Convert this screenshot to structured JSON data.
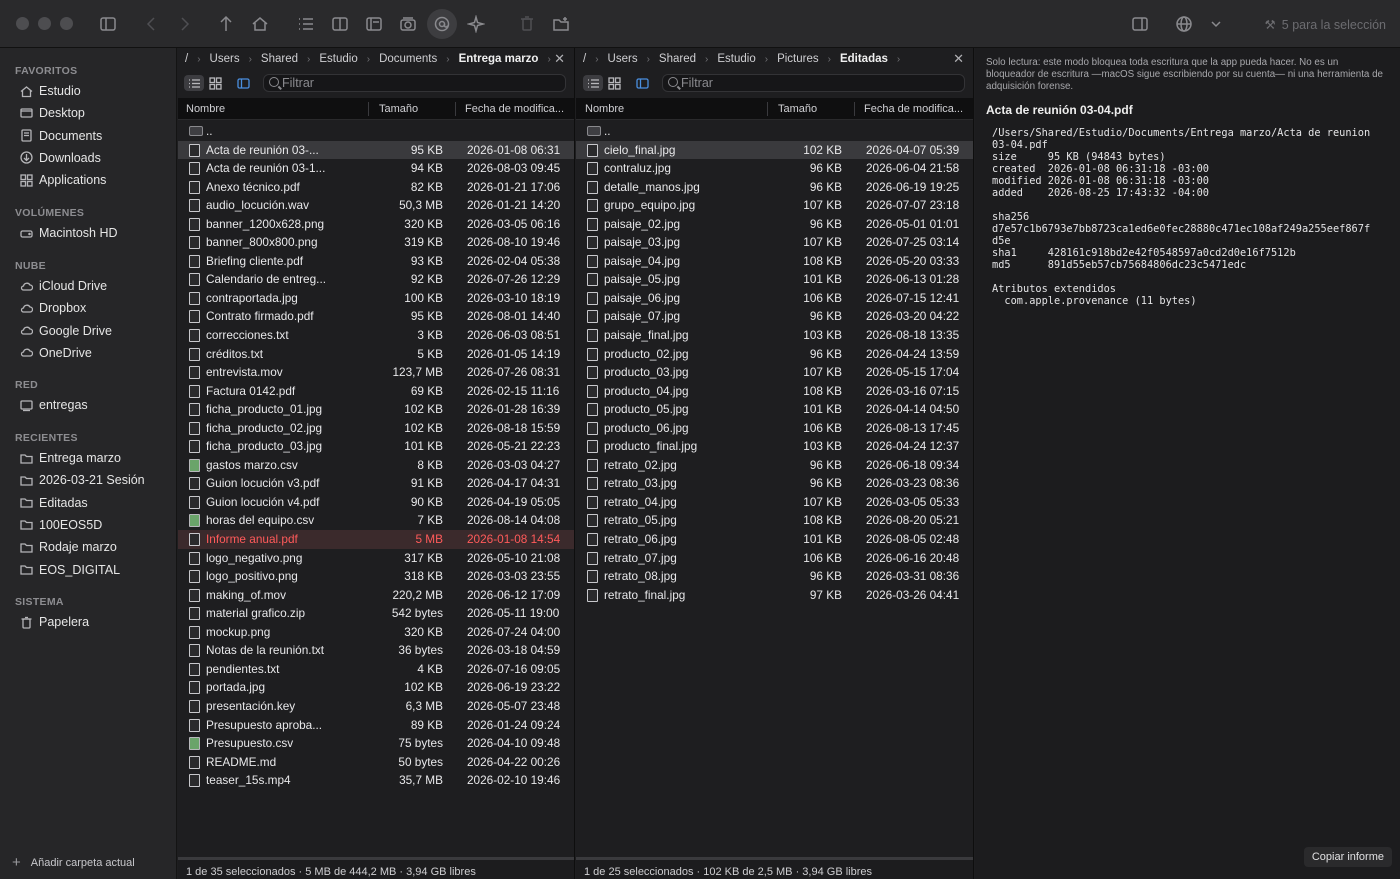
{
  "toolbar": {
    "selection_text": "5 para la selección"
  },
  "sidebar": {
    "favoritos_label": "FAVORITOS",
    "volumenes_label": "VOLÚMENES",
    "nube_label": "NUBE",
    "red_label": "RED",
    "recientes_label": "RECIENTES",
    "sistema_label": "SISTEMA",
    "favoritos": [
      "Estudio",
      "Desktop",
      "Documents",
      "Downloads",
      "Applications"
    ],
    "volumenes": [
      "Macintosh HD"
    ],
    "nube": [
      "iCloud Drive",
      "Dropbox",
      "Google Drive",
      "OneDrive"
    ],
    "red": [
      "entregas"
    ],
    "recientes": [
      "Entrega marzo",
      "2026-03-21 Sesión",
      "Editadas",
      "100EOS5D",
      "Rodaje marzo",
      "EOS_DIGITAL"
    ],
    "sistema": [
      "Papelera"
    ],
    "add_label": "Añadir carpeta actual"
  },
  "pane1": {
    "crumbs": [
      "/",
      "Users",
      "Shared",
      "Estudio",
      "Documents",
      "Entrega marzo"
    ],
    "filter_placeholder": "Filtrar",
    "col_name": "Nombre",
    "col_size": "Tamaño",
    "col_date": "Fecha de modifica...",
    "parent": "..",
    "files": [
      {
        "n": "Acta de reunión 03-...",
        "s": "95 KB",
        "d": "2026-01-08 06:31"
      },
      {
        "n": "Acta de reunión 03-1...",
        "s": "94 KB",
        "d": "2026-08-03 09:45"
      },
      {
        "n": "Anexo técnico.pdf",
        "s": "82 KB",
        "d": "2026-01-21 17:06"
      },
      {
        "n": "audio_locución.wav",
        "s": "50,3 MB",
        "d": "2026-01-21 14:20"
      },
      {
        "n": "banner_1200x628.png",
        "s": "320 KB",
        "d": "2026-03-05 06:16"
      },
      {
        "n": "banner_800x800.png",
        "s": "319 KB",
        "d": "2026-08-10 19:46"
      },
      {
        "n": "Briefing cliente.pdf",
        "s": "93 KB",
        "d": "2026-02-04 05:38"
      },
      {
        "n": "Calendario de entreg...",
        "s": "92 KB",
        "d": "2026-07-26 12:29"
      },
      {
        "n": "contraportada.jpg",
        "s": "100 KB",
        "d": "2026-03-10 18:19"
      },
      {
        "n": "Contrato firmado.pdf",
        "s": "95 KB",
        "d": "2026-08-01 14:40"
      },
      {
        "n": "correcciones.txt",
        "s": "3 KB",
        "d": "2026-06-03 08:51"
      },
      {
        "n": "créditos.txt",
        "s": "5 KB",
        "d": "2026-01-05 14:19"
      },
      {
        "n": "entrevista.mov",
        "s": "123,7 MB",
        "d": "2026-07-26 08:31"
      },
      {
        "n": "Factura 0142.pdf",
        "s": "69 KB",
        "d": "2026-02-15 11:16"
      },
      {
        "n": "ficha_producto_01.jpg",
        "s": "102 KB",
        "d": "2026-01-28 16:39"
      },
      {
        "n": "ficha_producto_02.jpg",
        "s": "102 KB",
        "d": "2026-08-18 15:59"
      },
      {
        "n": "ficha_producto_03.jpg",
        "s": "101 KB",
        "d": "2026-05-21 22:23"
      },
      {
        "n": "gastos marzo.csv",
        "s": "8 KB",
        "d": "2026-03-03 04:27"
      },
      {
        "n": "Guion locución v3.pdf",
        "s": "91 KB",
        "d": "2026-04-17 04:31"
      },
      {
        "n": "Guion locución v4.pdf",
        "s": "90 KB",
        "d": "2026-04-19 05:05"
      },
      {
        "n": "horas del equipo.csv",
        "s": "7 KB",
        "d": "2026-08-14 04:08"
      },
      {
        "n": "Informe anual.pdf",
        "s": "5 MB",
        "d": "2026-01-08 14:54"
      },
      {
        "n": "logo_negativo.png",
        "s": "317 KB",
        "d": "2026-05-10 21:08"
      },
      {
        "n": "logo_positivo.png",
        "s": "318 KB",
        "d": "2026-03-03 23:55"
      },
      {
        "n": "making_of.mov",
        "s": "220,2 MB",
        "d": "2026-06-12 17:09"
      },
      {
        "n": "material grafico.zip",
        "s": "542 bytes",
        "d": "2026-05-11 19:00"
      },
      {
        "n": "mockup.png",
        "s": "320 KB",
        "d": "2026-07-24 04:00"
      },
      {
        "n": "Notas de la reunión.txt",
        "s": "36 bytes",
        "d": "2026-03-18 04:59"
      },
      {
        "n": "pendientes.txt",
        "s": "4 KB",
        "d": "2026-07-16 09:05"
      },
      {
        "n": "portada.jpg",
        "s": "102 KB",
        "d": "2026-06-19 23:22"
      },
      {
        "n": "presentación.key",
        "s": "6,3 MB",
        "d": "2026-05-07 23:48"
      },
      {
        "n": "Presupuesto aproba...",
        "s": "89 KB",
        "d": "2026-01-24 09:24"
      },
      {
        "n": "Presupuesto.csv",
        "s": "75 bytes",
        "d": "2026-04-10 09:48"
      },
      {
        "n": "README.md",
        "s": "50 bytes",
        "d": "2026-04-22 00:26"
      },
      {
        "n": "teaser_15s.mp4",
        "s": "35,7 MB",
        "d": "2026-02-10 19:46"
      }
    ],
    "status": "1 de 35 seleccionados · 5 MB de 444,2 MB · 3,94 GB libres"
  },
  "pane2": {
    "crumbs": [
      "/",
      "Users",
      "Shared",
      "Estudio",
      "Pictures",
      "Editadas"
    ],
    "filter_placeholder": "Filtrar",
    "col_name": "Nombre",
    "col_size": "Tamaño",
    "col_date": "Fecha de modifica...",
    "parent": "..",
    "files": [
      {
        "n": "cielo_final.jpg",
        "s": "102 KB",
        "d": "2026-04-07 05:39"
      },
      {
        "n": "contraluz.jpg",
        "s": "96 KB",
        "d": "2026-06-04 21:58"
      },
      {
        "n": "detalle_manos.jpg",
        "s": "96 KB",
        "d": "2026-06-19 19:25"
      },
      {
        "n": "grupo_equipo.jpg",
        "s": "107 KB",
        "d": "2026-07-07 23:18"
      },
      {
        "n": "paisaje_02.jpg",
        "s": "96 KB",
        "d": "2026-05-01 01:01"
      },
      {
        "n": "paisaje_03.jpg",
        "s": "107 KB",
        "d": "2026-07-25 03:14"
      },
      {
        "n": "paisaje_04.jpg",
        "s": "108 KB",
        "d": "2026-05-20 03:33"
      },
      {
        "n": "paisaje_05.jpg",
        "s": "101 KB",
        "d": "2026-06-13 01:28"
      },
      {
        "n": "paisaje_06.jpg",
        "s": "106 KB",
        "d": "2026-07-15 12:41"
      },
      {
        "n": "paisaje_07.jpg",
        "s": "96 KB",
        "d": "2026-03-20 04:22"
      },
      {
        "n": "paisaje_final.jpg",
        "s": "103 KB",
        "d": "2026-08-18 13:35"
      },
      {
        "n": "producto_02.jpg",
        "s": "96 KB",
        "d": "2026-04-24 13:59"
      },
      {
        "n": "producto_03.jpg",
        "s": "107 KB",
        "d": "2026-05-15 17:04"
      },
      {
        "n": "producto_04.jpg",
        "s": "108 KB",
        "d": "2026-03-16 07:15"
      },
      {
        "n": "producto_05.jpg",
        "s": "101 KB",
        "d": "2026-04-14 04:50"
      },
      {
        "n": "producto_06.jpg",
        "s": "106 KB",
        "d": "2026-08-13 17:45"
      },
      {
        "n": "producto_final.jpg",
        "s": "103 KB",
        "d": "2026-04-24 12:37"
      },
      {
        "n": "retrato_02.jpg",
        "s": "96 KB",
        "d": "2026-06-18 09:34"
      },
      {
        "n": "retrato_03.jpg",
        "s": "96 KB",
        "d": "2026-03-23 08:36"
      },
      {
        "n": "retrato_04.jpg",
        "s": "107 KB",
        "d": "2026-03-05 05:33"
      },
      {
        "n": "retrato_05.jpg",
        "s": "108 KB",
        "d": "2026-08-20 05:21"
      },
      {
        "n": "retrato_06.jpg",
        "s": "101 KB",
        "d": "2026-08-05 02:48"
      },
      {
        "n": "retrato_07.jpg",
        "s": "106 KB",
        "d": "2026-06-16 20:48"
      },
      {
        "n": "retrato_08.jpg",
        "s": "96 KB",
        "d": "2026-03-31 08:36"
      },
      {
        "n": "retrato_final.jpg",
        "s": "97 KB",
        "d": "2026-03-26 04:41"
      }
    ],
    "status": "1 de 25 seleccionados · 102 KB de 2,5 MB · 3,94 GB libres"
  },
  "info": {
    "readonly_note": "Solo lectura: este modo bloquea toda escritura que la app pueda hacer. No es un bloqueador de escritura —macOS sigue escribiendo por su cuenta— ni una herramienta de adquisición forense.",
    "title": "Acta de reunión 03-04.pdf",
    "details": "/Users/Shared/Estudio/Documents/Entrega marzo/Acta de reunion\n03-04.pdf\nsize     95 KB (94843 bytes)\ncreated  2026-01-08 06:31:18 -03:00\nmodified 2026-01-08 06:31:18 -03:00\nadded    2026-08-25 17:43:32 -04:00\n\nsha256\nd7e57c1b6793e7bb8723ca1ed6e0fec28880c471ec108af249a255eef867f\nd5e\nsha1     428161c918bd2e42f0548597a0cd2d0e16f7512b\nmd5      891d55eb57cb75684806dc23c5471edc\n\nAtributos extendidos\n  com.apple.provenance (11 bytes)",
    "copy_label": "Copiar informe"
  }
}
